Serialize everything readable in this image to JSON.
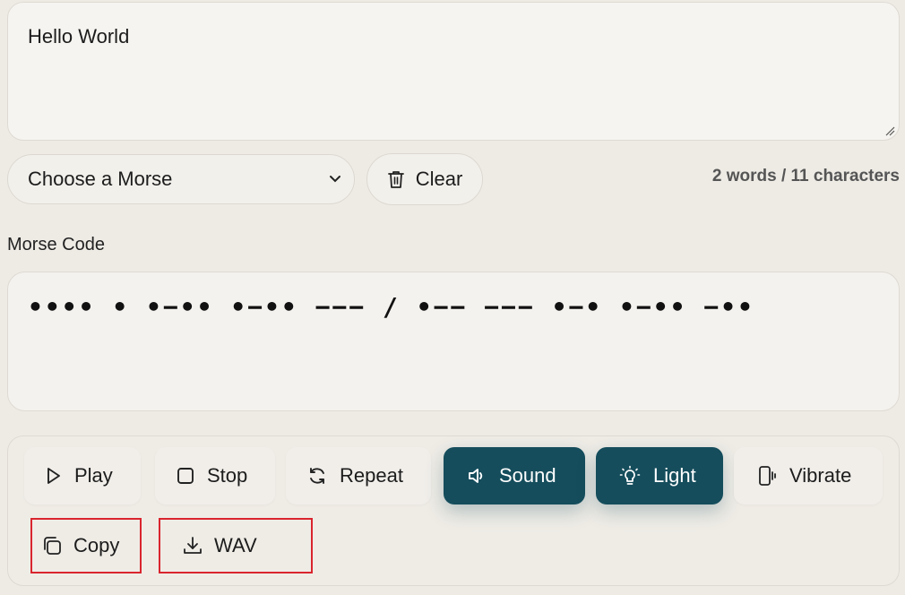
{
  "input": {
    "text": "Hello World"
  },
  "select": {
    "selected": "Choose a Morse"
  },
  "clear_label": "Clear",
  "stats": {
    "text": "2 words / 11 characters"
  },
  "output": {
    "label": "Morse Code",
    "morse": "•••• • •−•• •−•• −−−  / •−− −−− •−• •−•• −••"
  },
  "controls": {
    "play": "Play",
    "stop": "Stop",
    "repeat": "Repeat",
    "sound": "Sound",
    "light": "Light",
    "vibrate": "Vibrate",
    "copy": "Copy",
    "wav": "WAV",
    "active": [
      "sound",
      "light"
    ]
  },
  "colors": {
    "active_button": "#154d5c",
    "highlight_border": "#d9252e",
    "background": "#eeebe5"
  },
  "icons": {
    "clear": "trash-icon",
    "play": "play-icon",
    "stop": "stop-icon",
    "repeat": "refresh-icon",
    "sound": "speaker-icon",
    "light": "lightbulb-icon",
    "vibrate": "vibrate-phone-icon",
    "copy": "copy-icon",
    "wav": "download-icon"
  }
}
